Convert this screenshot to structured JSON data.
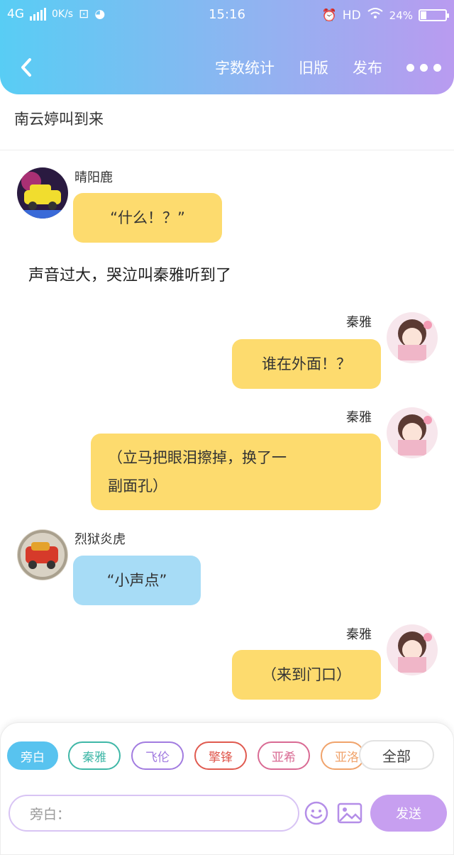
{
  "status_bar": {
    "network": "4G",
    "speed": "0K/s",
    "time": "15:16",
    "hd": "HD",
    "battery": "24%"
  },
  "header": {
    "word_count": "字数统计",
    "old_version": "旧版",
    "publish": "发布"
  },
  "story_title": "南云婷叫到来",
  "messages": [
    {
      "type": "left",
      "name": "晴阳鹿",
      "text": "“什么！？”",
      "bubble_color": "#fddb6e"
    },
    {
      "type": "narration",
      "text": "声音过大，哭泣叫秦雅听到了"
    },
    {
      "type": "right",
      "name": "秦雅",
      "text": "谁在外面！？",
      "bubble_color": "#fddb6e"
    },
    {
      "type": "right",
      "name": "秦雅",
      "text_line1": "（立马把眼泪擦掉，换了一",
      "text_line2": "副面孔）",
      "bubble_color": "#fddb6e"
    },
    {
      "type": "left",
      "name": "烈狱炎虎",
      "text": "“小声点”",
      "bubble_color": "#a7dcf6"
    },
    {
      "type": "right",
      "name": "秦雅",
      "text": "（来到门口）",
      "bubble_color": "#fddb6e"
    }
  ],
  "role_chips": [
    {
      "label": "旁白",
      "color": "#58c3ef",
      "active": true
    },
    {
      "label": "秦雅",
      "color": "#3fb7a7",
      "active": false
    },
    {
      "label": "飞伦",
      "color": "#a27ce0",
      "active": false
    },
    {
      "label": "擎锋",
      "color": "#e05a4f",
      "active": false
    },
    {
      "label": "亚希",
      "color": "#d96a93",
      "active": false
    },
    {
      "label": "亚洛",
      "color": "#f0a36b",
      "active": false
    }
  ],
  "all_button": "全部",
  "input": {
    "placeholder": "旁白："
  },
  "send_button": "发送",
  "icons": [
    "back-icon",
    "more-icon",
    "emoji-icon",
    "image-icon",
    "battery-icon",
    "wifi-icon",
    "signal-icon",
    "alarm-icon"
  ]
}
